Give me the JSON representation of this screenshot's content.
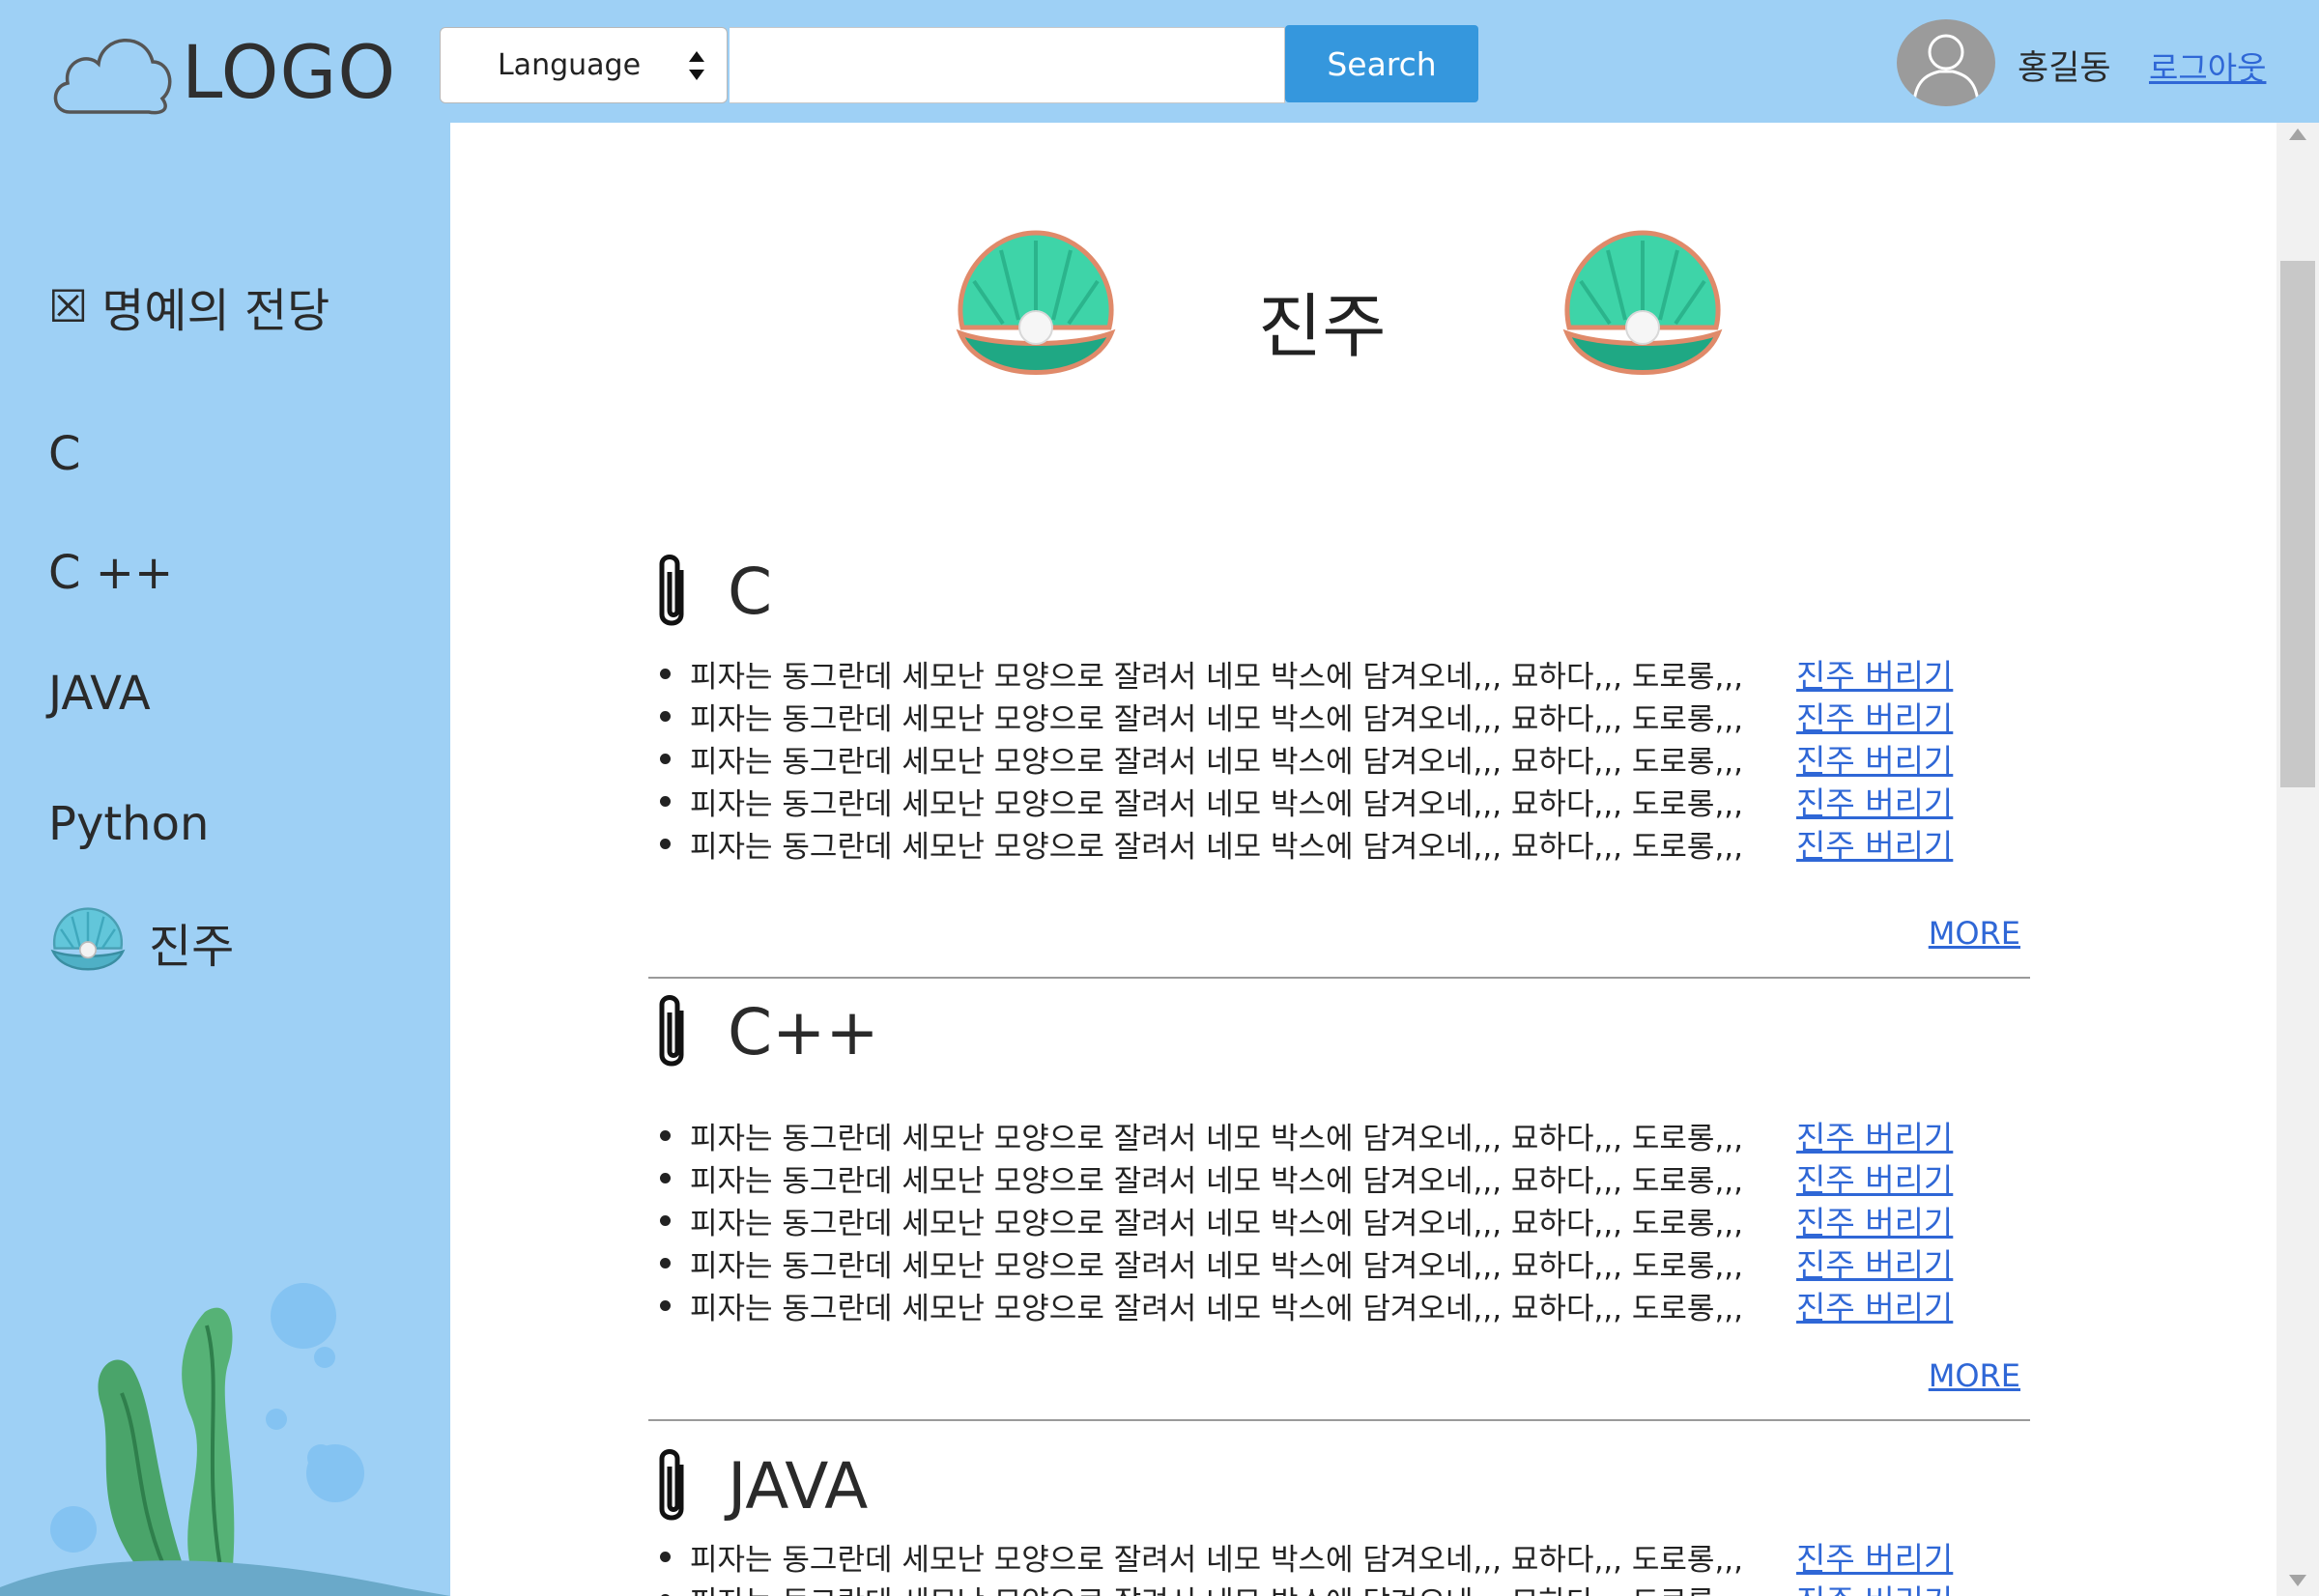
{
  "header": {
    "logo_text": "LOGO",
    "language_label": "Language",
    "search_value": "",
    "search_button": "Search",
    "username": "홍길동",
    "logout_label": "로그아웃"
  },
  "sidebar": {
    "items": [
      {
        "label": "명예의 전당",
        "prefix": "☒"
      },
      {
        "label": "C"
      },
      {
        "label": "C ++"
      },
      {
        "label": "JAVA"
      },
      {
        "label": "Python"
      },
      {
        "label": "진주"
      }
    ]
  },
  "main": {
    "page_title": "진주",
    "sections": [
      {
        "title": "C",
        "items": [
          {
            "text": "피자는 동그란데 세모난 모양으로 잘려서 네모 박스에 담겨오네,,, 묘하다,,, 도로롱,,,",
            "link": "진주 버리기"
          },
          {
            "text": "피자는 동그란데 세모난 모양으로 잘려서 네모 박스에 담겨오네,,, 묘하다,,, 도로롱,,,",
            "link": "진주 버리기"
          },
          {
            "text": "피자는 동그란데 세모난 모양으로 잘려서 네모 박스에 담겨오네,,, 묘하다,,, 도로롱,,,",
            "link": "진주 버리기"
          },
          {
            "text": "피자는 동그란데 세모난 모양으로 잘려서 네모 박스에 담겨오네,,, 묘하다,,, 도로롱,,,",
            "link": "진주 버리기"
          },
          {
            "text": "피자는 동그란데 세모난 모양으로 잘려서 네모 박스에 담겨오네,,, 묘하다,,, 도로롱,,,",
            "link": "진주 버리기"
          }
        ],
        "more": "MORE"
      },
      {
        "title": "C++",
        "items": [
          {
            "text": "피자는 동그란데 세모난 모양으로 잘려서 네모 박스에 담겨오네,,, 묘하다,,, 도로롱,,,",
            "link": "진주 버리기"
          },
          {
            "text": "피자는 동그란데 세모난 모양으로 잘려서 네모 박스에 담겨오네,,, 묘하다,,, 도로롱,,,",
            "link": "진주 버리기"
          },
          {
            "text": "피자는 동그란데 세모난 모양으로 잘려서 네모 박스에 담겨오네,,, 묘하다,,, 도로롱,,,",
            "link": "진주 버리기"
          },
          {
            "text": "피자는 동그란데 세모난 모양으로 잘려서 네모 박스에 담겨오네,,, 묘하다,,, 도로롱,,,",
            "link": "진주 버리기"
          },
          {
            "text": "피자는 동그란데 세모난 모양으로 잘려서 네모 박스에 담겨오네,,, 묘하다,,, 도로롱,,,",
            "link": "진주 버리기"
          }
        ],
        "more": "MORE"
      },
      {
        "title": "JAVA",
        "items": [
          {
            "text": "피자는 동그란데 세모난 모양으로 잘려서 네모 박스에 담겨오네,,, 묘하다,,, 도로롱,,,",
            "link": "진주 버리기"
          },
          {
            "text": "피자는 동그란데 세모난 모양으로 잘려서 네모 박스에 담겨오네,,, 묘하다,,, 도로롱,,,",
            "link": "진주 버리기"
          }
        ]
      }
    ]
  }
}
